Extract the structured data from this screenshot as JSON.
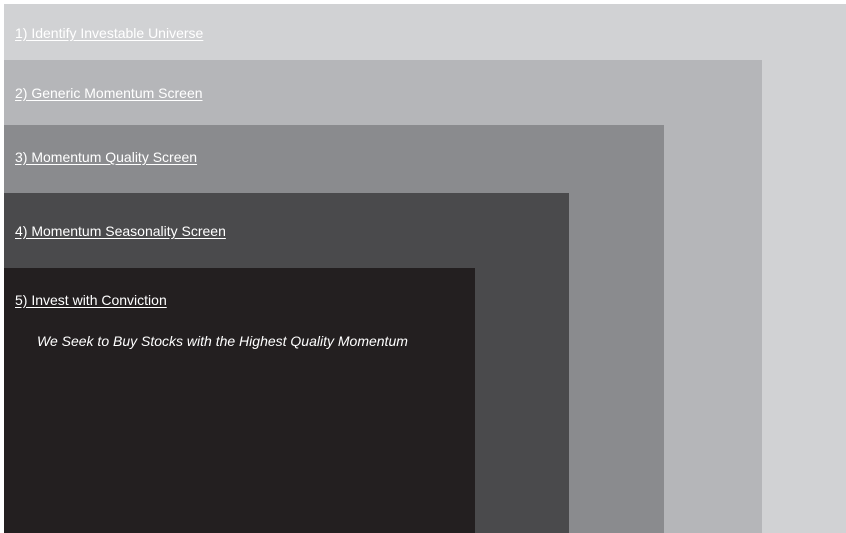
{
  "steps": [
    {
      "label": "1) Identify Investable Universe",
      "color": "#d1d2d4"
    },
    {
      "label": "2) Generic Momentum Screen",
      "color": "#b5b6b9"
    },
    {
      "label": "3) Momentum Quality Screen",
      "color": "#8a8b8e"
    },
    {
      "label": "4) Momentum Seasonality Screen",
      "color": "#4a4a4c"
    },
    {
      "label": "5) Invest with Conviction",
      "color": "#231f20"
    }
  ],
  "tagline": "We Seek to Buy Stocks with the Highest Quality Momentum"
}
